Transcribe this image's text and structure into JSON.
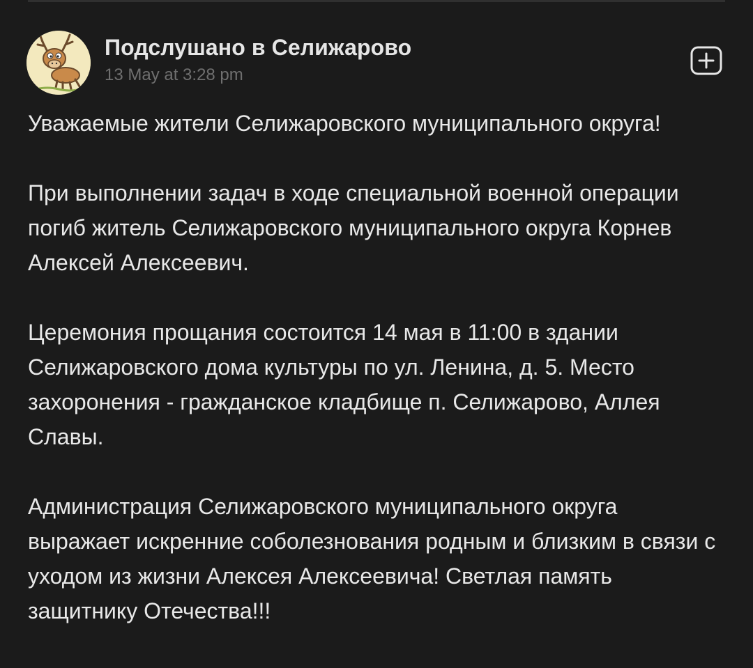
{
  "post": {
    "author": "Подслушано в Селижарово",
    "date": "13 May at 3:28 pm",
    "avatar_icon": "reindeer-cartoon-avatar",
    "action_icon": "add-square-icon",
    "paragraphs": [
      "Уважаемые жители Селижаровского муниципального округа!",
      "При выполнении задач в ходе специальной военной операции погиб житель Селижаровского муниципального округа Корнев Алексей Алексеевич.",
      "Церемония прощания состоится 14 мая в 11:00 в здании Селижаровского дома культуры по ул. Ленина, д. 5. Место захоронения - гражданское кладбище п. Селижарово, Аллея Славы.",
      "Администрация Селижаровского муниципального округа выражает искренние соболезнования родным и близким в связи с уходом из жизни Алексея Алексеевича! Светлая память защитнику Отечества!!!"
    ]
  },
  "colors": {
    "background": "#1b1b1b",
    "text": "#e8e8e8",
    "secondary_text": "#6f6f6f"
  }
}
